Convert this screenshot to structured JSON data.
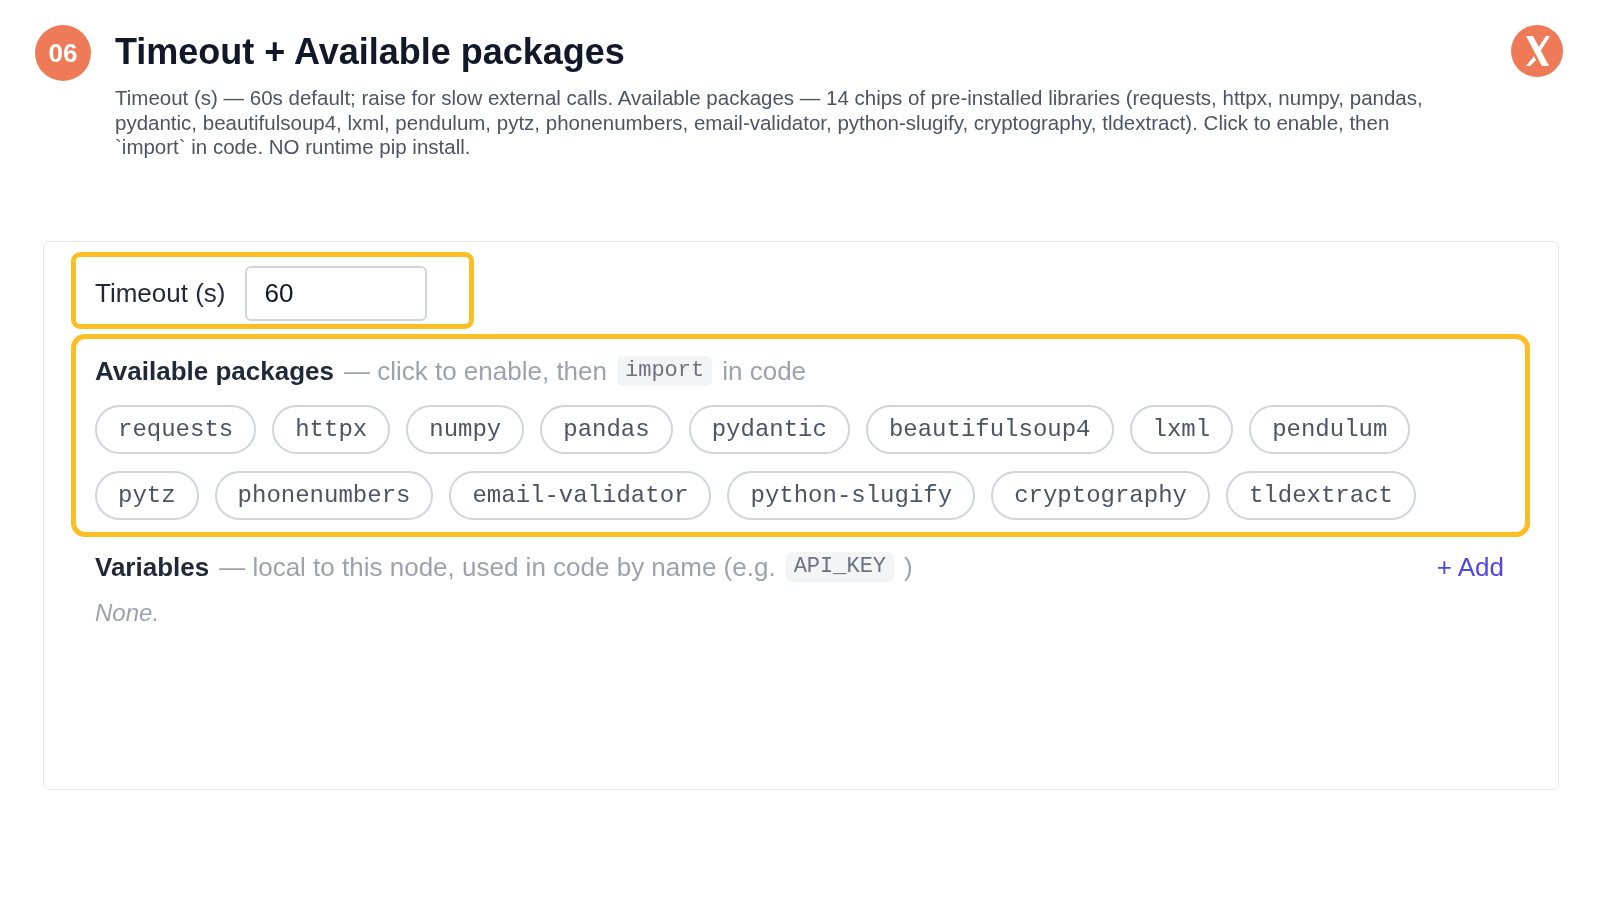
{
  "header": {
    "badge": "06",
    "title": "Timeout + Available packages",
    "description": "Timeout (s) — 60s default; raise for slow external calls. Available packages — 14 chips of pre-installed libraries (requests, httpx, numpy, pandas, pydantic, beautifulsoup4, lxml, pendulum, pytz, phonenumbers, email-validator, python-slugify, cryptography, tldextract). Click to enable, then `import` in code. NO runtime pip install."
  },
  "timeout": {
    "highlighted": true,
    "label": "Timeout (s)",
    "value": "60"
  },
  "packages": {
    "highlighted": true,
    "label": "Available packages",
    "hint_parts": [
      {
        "kind": "text",
        "text": "— click to enable, then"
      },
      {
        "kind": "code",
        "text": "import"
      },
      {
        "kind": "text",
        "text": "in code"
      }
    ],
    "chips": [
      {
        "label": "requests",
        "selected": false
      },
      {
        "label": "httpx",
        "selected": false
      },
      {
        "label": "numpy",
        "selected": false
      },
      {
        "label": "pandas",
        "selected": false
      },
      {
        "label": "pydantic",
        "selected": false
      },
      {
        "label": "beautifulsoup4",
        "selected": false
      },
      {
        "label": "lxml",
        "selected": false
      },
      {
        "label": "pendulum",
        "selected": false
      },
      {
        "label": "pytz",
        "selected": false
      },
      {
        "label": "phonenumbers",
        "selected": false
      },
      {
        "label": "email-validator",
        "selected": false
      },
      {
        "label": "python-slugify",
        "selected": false
      },
      {
        "label": "cryptography",
        "selected": false
      },
      {
        "label": "tldextract",
        "selected": false
      }
    ]
  },
  "variables": {
    "label": "Variables",
    "hint_parts": [
      {
        "kind": "text",
        "text": "— local to this node, used in code by name (e.g."
      },
      {
        "kind": "code",
        "text": "API_KEY"
      },
      {
        "kind": "text",
        "text": ")"
      }
    ],
    "add_button": "+ Add",
    "empty_text": "None."
  }
}
